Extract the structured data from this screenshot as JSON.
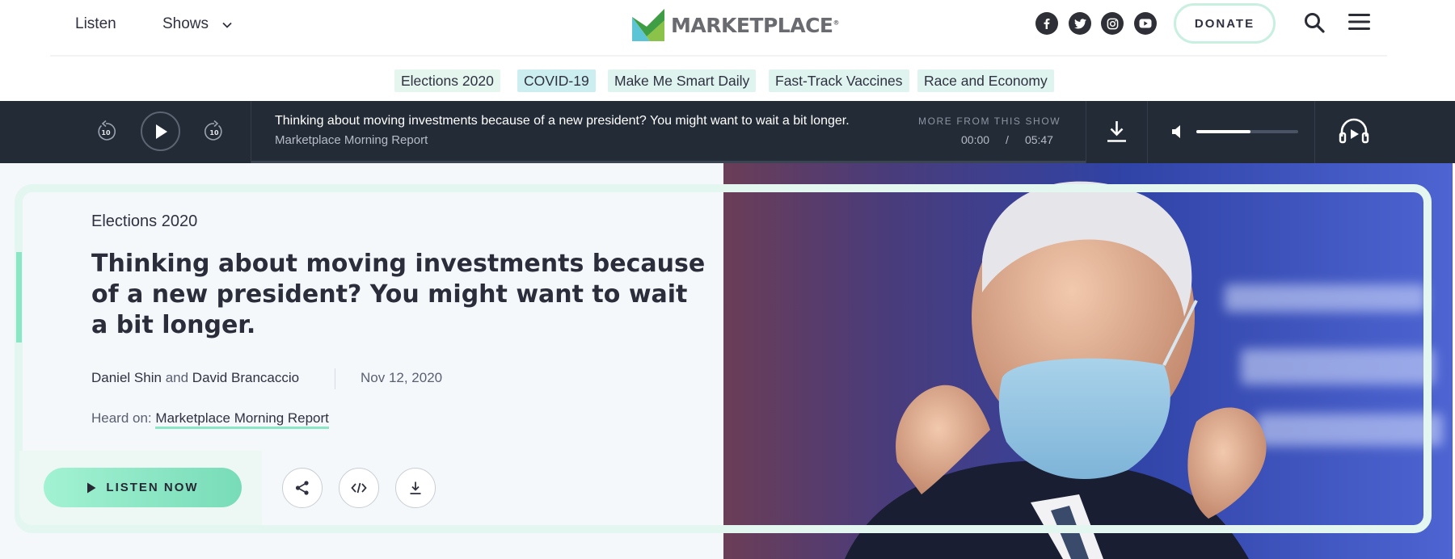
{
  "nav": {
    "listen_label": "Listen",
    "shows_label": "Shows",
    "logo_text": "MARKETPLACE",
    "logo_mark": "®",
    "social": [
      "facebook-icon",
      "twitter-icon",
      "instagram-icon",
      "youtube-icon"
    ],
    "donate_label": "DONATE"
  },
  "tags": [
    "Elections 2020",
    "COVID-19",
    "Make Me Smart Daily",
    "Fast-Track Vaccines",
    "Race and Economy"
  ],
  "player": {
    "skip_back_seconds": "10",
    "skip_forward_seconds": "10",
    "episode_title": "Thinking about moving investments because of a new president? You might want to wait a bit longer.",
    "show_name": "Marketplace Morning Report",
    "more_label": "MORE FROM THIS SHOW",
    "current_time": "00:00",
    "time_separator": "/",
    "duration": "05:47",
    "progress_fraction": 0,
    "volume_fraction": 0.53
  },
  "article": {
    "category": "Elections 2020",
    "headline": "Thinking about moving investments because of a new president? You might want to wait a bit longer.",
    "author_1": "Daniel Shin",
    "and_text": "and",
    "author_2": "David Brancaccio",
    "date": "Nov 12, 2020",
    "heard_on_label": "Heard on:",
    "heard_on_show": "Marketplace Morning Report",
    "listen_now_label": "LISTEN NOW"
  },
  "colors": {
    "accent": "#8ae6c4",
    "player_bg": "#232b37",
    "tag_bg": "#dff3ef"
  }
}
